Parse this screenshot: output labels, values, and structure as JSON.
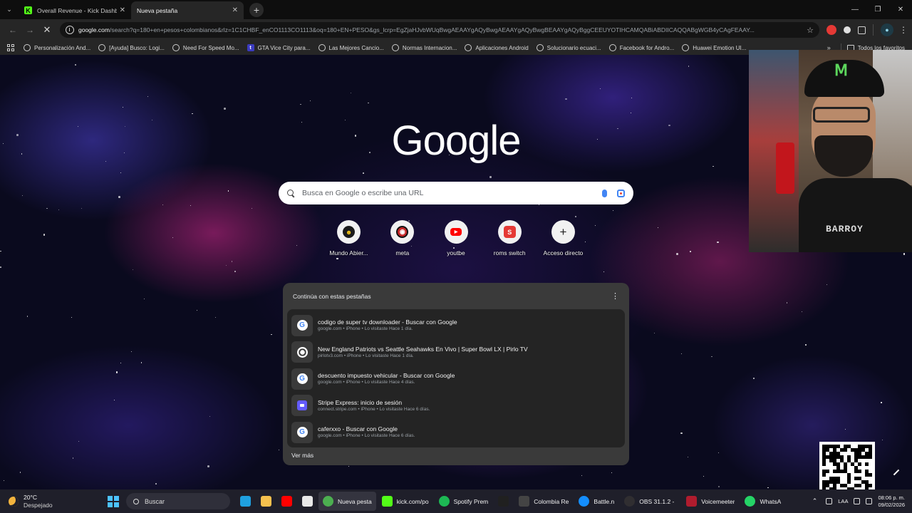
{
  "tabs": [
    {
      "title": "Overall Revenue - Kick Dashbo",
      "favicon": "kick-icon",
      "active": false
    },
    {
      "title": "Nueva pestaña",
      "favicon": "",
      "active": true
    }
  ],
  "toolbar": {
    "url_host": "google.com",
    "url_path": "/search?q=180+en+pesos+colombianos&rlz=1C1CHBF_enCO1113CO1113&oq=180+EN+PESO&gs_lcrp=EgZjaHJvbWUqBwgAEAAYgAQyBwgAEAAYgAQyBwgBEAAYgAQyBggCEEUYOTIHCAMQABiABDIICAQQABgWGB4yCAgFEAAY..."
  },
  "bookmarks": [
    "Personalización And...",
    "[Ayuda] Busco: Logi...",
    "Need For Speed Mo...",
    "GTA Vice City para...",
    "Las Mejores Cancio...",
    "Normas Internacion...",
    "Aplicaciones Android",
    "Solucionario ecuaci...",
    "Facebook for Andro...",
    "Huawei Emotion UI..."
  ],
  "all_bookmarks_label": "Todos los favoritos",
  "ntp": {
    "logo": "Google",
    "search_placeholder": "Busca en Google o escribe una URL",
    "shortcuts": [
      {
        "label": "Mundo Abier...",
        "icon": "mundo-abierto-icon"
      },
      {
        "label": "meta",
        "icon": "meta-icon"
      },
      {
        "label": "youtbe",
        "icon": "youtube-icon"
      },
      {
        "label": "roms switch",
        "icon": "roms-switch-icon"
      },
      {
        "label": "Acceso directo",
        "icon": "plus-icon"
      }
    ],
    "resume": {
      "title": "Continúa con estas pestañas",
      "items": [
        {
          "title": "codigo de super tv downloader - Buscar con Google",
          "sub": "google.com • iPhone • Lo visitaste Hace 1 día.",
          "icon": "google-icon"
        },
        {
          "title": "New England Patriots vs Seattle Seahawks En Vivo | Super Bowl LX | Pirlo TV",
          "sub": "pirlotv3.com • iPhone • Lo visitaste Hace 1 día.",
          "icon": "soccer-ball-icon"
        },
        {
          "title": "descuento impuesto vehicular - Buscar con Google",
          "sub": "google.com • iPhone • Lo visitaste Hace 4 días.",
          "icon": "google-icon"
        },
        {
          "title": "Stripe Express: inicio de sesión",
          "sub": "connect.stripe.com • iPhone • Lo visitaste Hace 6 días.",
          "icon": "stripe-icon"
        },
        {
          "title": "caferxxo - Buscar con Google",
          "sub": "google.com • iPhone • Lo visitaste Hace 6 días.",
          "icon": "google-icon"
        }
      ],
      "see_more": "Ver más"
    }
  },
  "webcam": {
    "shirt_text": "BARROY"
  },
  "taskbar": {
    "weather_temp": "20°C",
    "weather_desc": "Despejado",
    "search_label": "Buscar",
    "apps": [
      {
        "label": "",
        "icon": "edge-icon",
        "color": "#1fa0e0"
      },
      {
        "label": "",
        "icon": "file-explorer-icon",
        "color": "#f4c04e"
      },
      {
        "label": "",
        "icon": "youtube-icon",
        "color": "#ff0000"
      },
      {
        "label": "",
        "icon": "store-icon",
        "color": "#e8e8e8"
      },
      {
        "label": "Nueva pesta",
        "icon": "chrome-icon",
        "color": "#4caf50"
      },
      {
        "label": "kick.com/po",
        "icon": "kick-icon",
        "color": "#53fc18"
      },
      {
        "label": "Spotify Prem",
        "icon": "spotify-icon",
        "color": "#1db954"
      },
      {
        "label": "",
        "icon": "tiktok-icon",
        "color": "#202020"
      },
      {
        "label": "Colombia Re",
        "icon": "fifa-icon",
        "color": "#444444"
      },
      {
        "label": "Battle.n",
        "icon": "battlenet-icon",
        "color": "#148eff"
      },
      {
        "label": "OBS 31.1.2 - I",
        "icon": "obs-icon",
        "color": "#302e31"
      },
      {
        "label": "Voicemeeter",
        "icon": "voicemeeter-icon",
        "color": "#b01c2e"
      },
      {
        "label": "WhatsA",
        "icon": "whatsapp-icon",
        "color": "#25d366"
      }
    ],
    "lang": "LAA",
    "time": "08:06 p. m.",
    "date": "09/02/2026"
  }
}
